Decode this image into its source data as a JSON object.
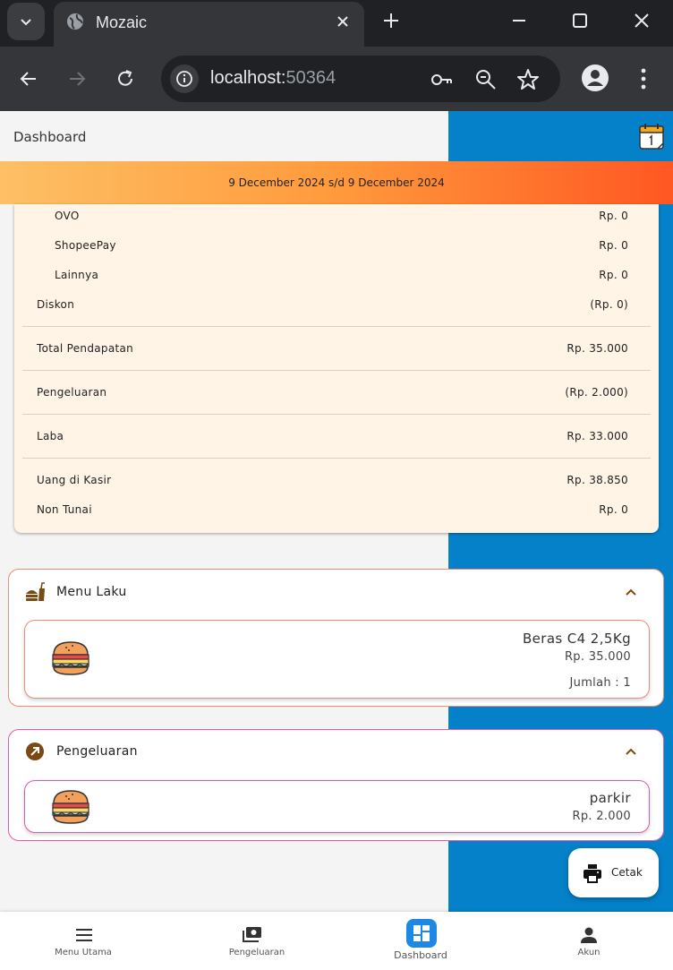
{
  "browser": {
    "tab_title": "Mozaic",
    "url_host": "localhost:",
    "url_port": "50364"
  },
  "app": {
    "title": "Dashboard",
    "date_range": "9 December 2024 s/d 9 December 2024"
  },
  "summary": {
    "rows": [
      {
        "label": "OVO",
        "value": "Rp. 0"
      },
      {
        "label": "ShopeePay",
        "value": "Rp. 0"
      },
      {
        "label": "Lainnya",
        "value": "Rp. 0"
      },
      {
        "label": "Diskon",
        "value": "(Rp. 0)"
      },
      {
        "label": "Total Pendapatan",
        "value": "Rp. 35.000"
      },
      {
        "label": "Pengeluaran",
        "value": "(Rp. 2.000)"
      },
      {
        "label": "Laba",
        "value": "Rp. 33.000"
      },
      {
        "label": "Uang di Kasir",
        "value": "Rp. 38.850"
      },
      {
        "label": "Non Tunai",
        "value": "Rp. 0"
      }
    ]
  },
  "menu_laku": {
    "title": "Menu Laku",
    "border_color": "#f08c7c",
    "item": {
      "name": "Beras C4 2,5Kg",
      "price": "Rp. 35.000",
      "qty": "Jumlah : 1"
    }
  },
  "pengeluaran": {
    "title": "Pengeluaran",
    "border_color": "#e05aa8",
    "item": {
      "name": "parkir",
      "price": "Rp. 2.000"
    }
  },
  "cetak_label": "Cetak",
  "bottom_nav": {
    "items": [
      {
        "label": "Menu Utama",
        "icon": "menu-icon"
      },
      {
        "label": "Pengeluaran",
        "icon": "cash-icon"
      },
      {
        "label": "Dashboard",
        "icon": "dashboard-icon",
        "active": true
      },
      {
        "label": "Akun",
        "icon": "person-icon"
      }
    ]
  },
  "colors": {
    "accent_blue": "#0581c9",
    "card_bg": "#fff4e6",
    "icon_brown": "#7a4a12"
  }
}
